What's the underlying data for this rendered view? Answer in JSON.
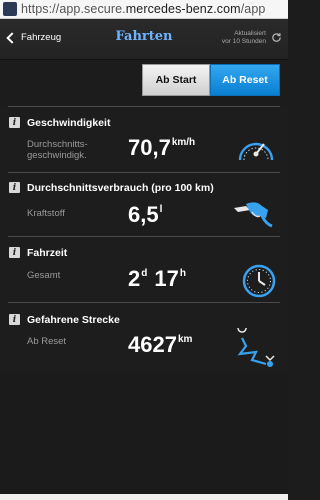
{
  "browser": {
    "url_prefix": "https://app.secure.",
    "url_domain": "mercedes-benz.com",
    "url_suffix": "/app"
  },
  "header": {
    "back_label": "Fahrzeug",
    "title": "Fahrten",
    "updated_line1": "Aktualisiert",
    "updated_line2": "vor 10 Stunden"
  },
  "segments": {
    "start_label": "Ab Start",
    "reset_label": "Ab Reset",
    "selected": "Ab Reset"
  },
  "cards": [
    {
      "title": "Geschwindigkeit",
      "sub_line1": "Durchschnitts-",
      "sub_line2": "geschwindigk.",
      "value": "70,7",
      "unit": "km/h",
      "icon": "speedometer-icon"
    },
    {
      "title": "Durchschnittsverbrauch (pro 100 km)",
      "sub_line1": "Kraftstoff",
      "value": "6,5",
      "unit": "l",
      "icon": "fuel-nozzle-icon"
    },
    {
      "title": "Fahrzeit",
      "sub_line1": "Gesamt",
      "value_days": "2",
      "unit_days": "d",
      "value_hours": "17",
      "unit_hours": "h",
      "icon": "clock-icon"
    },
    {
      "title": "Gefahrene Strecke",
      "sub_line1": "Ab Reset",
      "value": "4627",
      "unit": "km",
      "icon": "route-icon"
    }
  ],
  "colors": {
    "accent_blue": "#0a8ae0",
    "title_blue": "#6fb3ff",
    "icon_blue": "#39a2f0"
  }
}
